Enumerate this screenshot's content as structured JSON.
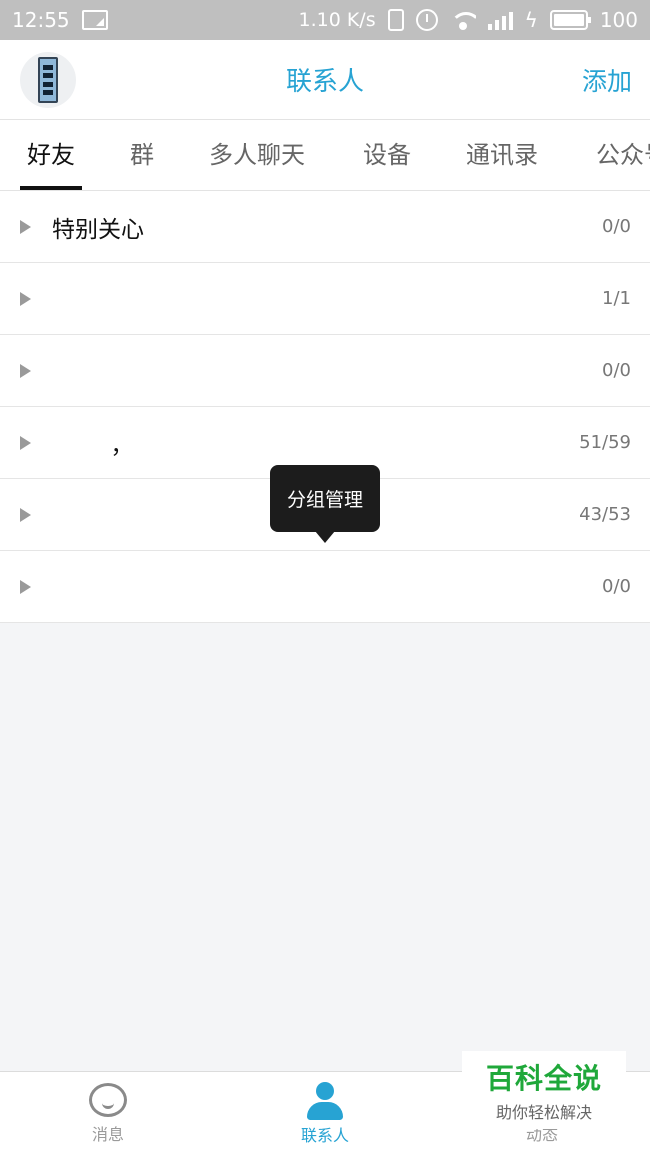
{
  "status_bar": {
    "time": "12:55",
    "speed": "1.10 K/s",
    "battery": "100"
  },
  "header": {
    "title": "联系人",
    "add_label": "添加"
  },
  "tabs": [
    {
      "label": "好友",
      "active": true
    },
    {
      "label": "群",
      "active": false
    },
    {
      "label": "多人聊天",
      "active": false
    },
    {
      "label": "设备",
      "active": false
    },
    {
      "label": "通讯录",
      "active": false
    },
    {
      "label": "公众号",
      "active": false
    }
  ],
  "groups": [
    {
      "name": "特别关心",
      "count": "0/0"
    },
    {
      "name": "",
      "count": "1/1"
    },
    {
      "name": "",
      "count": "0/0"
    },
    {
      "name": "        ，",
      "count": "51/59"
    },
    {
      "name": "",
      "count": "43/53"
    },
    {
      "name": "",
      "count": "0/0"
    }
  ],
  "tooltip": {
    "text": "分组管理"
  },
  "bottom_nav": [
    {
      "label": "消息",
      "icon": "chat-bubble-icon",
      "active": false
    },
    {
      "label": "联系人",
      "icon": "person-icon",
      "active": true
    },
    {
      "label": "动态",
      "icon": "star-icon",
      "active": false
    }
  ],
  "watermark": {
    "title": "百科全说",
    "subtitle": "助你轻松解决"
  },
  "colors": {
    "accent": "#27a3d3",
    "status_bar_bg": "#bfbfbf",
    "watermark_green": "#1fa83a"
  }
}
